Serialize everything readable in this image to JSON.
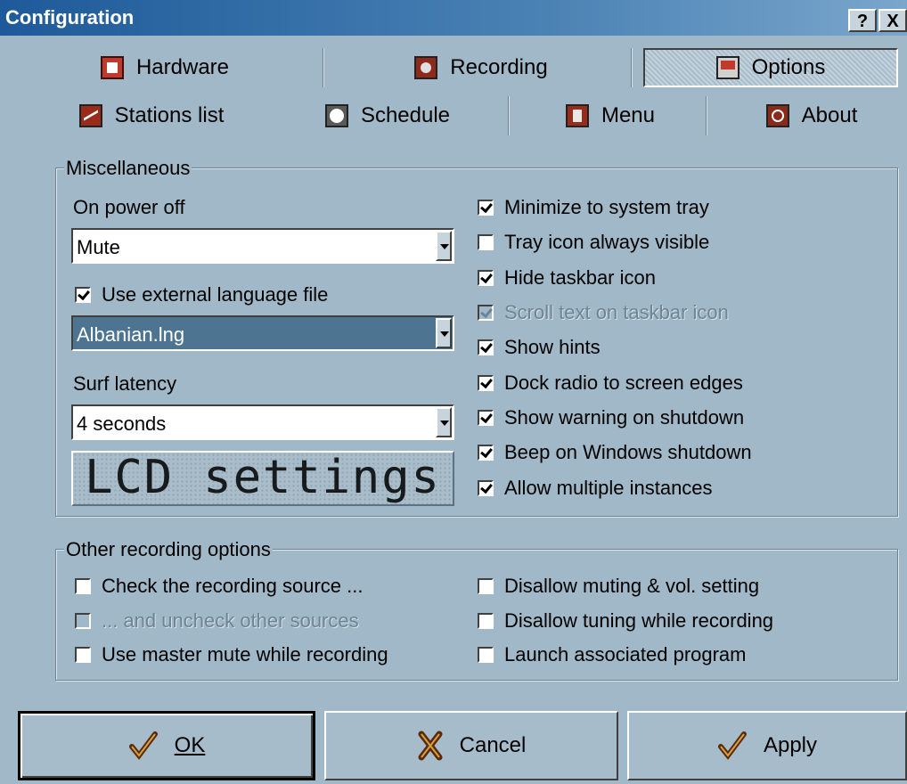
{
  "window": {
    "title": "Configuration",
    "help_btn": "?",
    "close_btn": "X"
  },
  "tabs_row1": [
    {
      "label": "Hardware",
      "icon": "hardware-icon",
      "active": false
    },
    {
      "label": "Recording",
      "icon": "recording-icon",
      "active": false
    },
    {
      "label": "Options",
      "icon": "options-icon",
      "active": true
    }
  ],
  "tabs_row2": [
    {
      "label": "Stations list",
      "icon": "stations-list-icon"
    },
    {
      "label": "Schedule",
      "icon": "schedule-icon"
    },
    {
      "label": "Menu",
      "icon": "menu-icon"
    },
    {
      "label": "About",
      "icon": "about-icon"
    }
  ],
  "misc": {
    "legend": "Miscellaneous",
    "on_power_off_label": "On power off",
    "on_power_off_value": "Mute",
    "use_language_file": {
      "label": "Use external language file",
      "checked": true
    },
    "language_value": "Albanian.lng",
    "surf_latency_label": "Surf latency",
    "surf_latency_value": "4 seconds",
    "lcd_button": "LCD settings",
    "options": [
      {
        "label": "Minimize to system tray",
        "checked": true,
        "enabled": true
      },
      {
        "label": "Tray icon always visible",
        "checked": false,
        "enabled": true
      },
      {
        "label": "Hide taskbar icon",
        "checked": true,
        "enabled": true
      },
      {
        "label": "Scroll text on taskbar icon",
        "checked": true,
        "enabled": false
      },
      {
        "label": "Show hints",
        "checked": true,
        "enabled": true
      },
      {
        "label": "Dock radio to screen edges",
        "checked": true,
        "enabled": true
      },
      {
        "label": "Show warning on shutdown",
        "checked": true,
        "enabled": true
      },
      {
        "label": "Beep on Windows shutdown",
        "checked": true,
        "enabled": true
      },
      {
        "label": "Allow multiple instances",
        "checked": true,
        "enabled": true
      }
    ]
  },
  "recording": {
    "legend": "Other recording options",
    "left": [
      {
        "label": "Check the recording source ...",
        "checked": false,
        "enabled": true
      },
      {
        "label": "... and uncheck other sources",
        "checked": false,
        "enabled": false
      },
      {
        "label": "Use master mute while recording",
        "checked": false,
        "enabled": true
      }
    ],
    "right": [
      {
        "label": "Disallow muting & vol. setting",
        "checked": false,
        "enabled": true
      },
      {
        "label": "Disallow tuning while recording",
        "checked": false,
        "enabled": true
      },
      {
        "label": "Launch associated program",
        "checked": false,
        "enabled": true
      }
    ]
  },
  "buttons": {
    "ok": {
      "label": "OK",
      "icon": "ok-check-icon"
    },
    "cancel": {
      "label": "Cancel",
      "icon": "cancel-x-icon"
    },
    "apply": {
      "label": "Apply",
      "icon": "apply-check-icon"
    }
  }
}
